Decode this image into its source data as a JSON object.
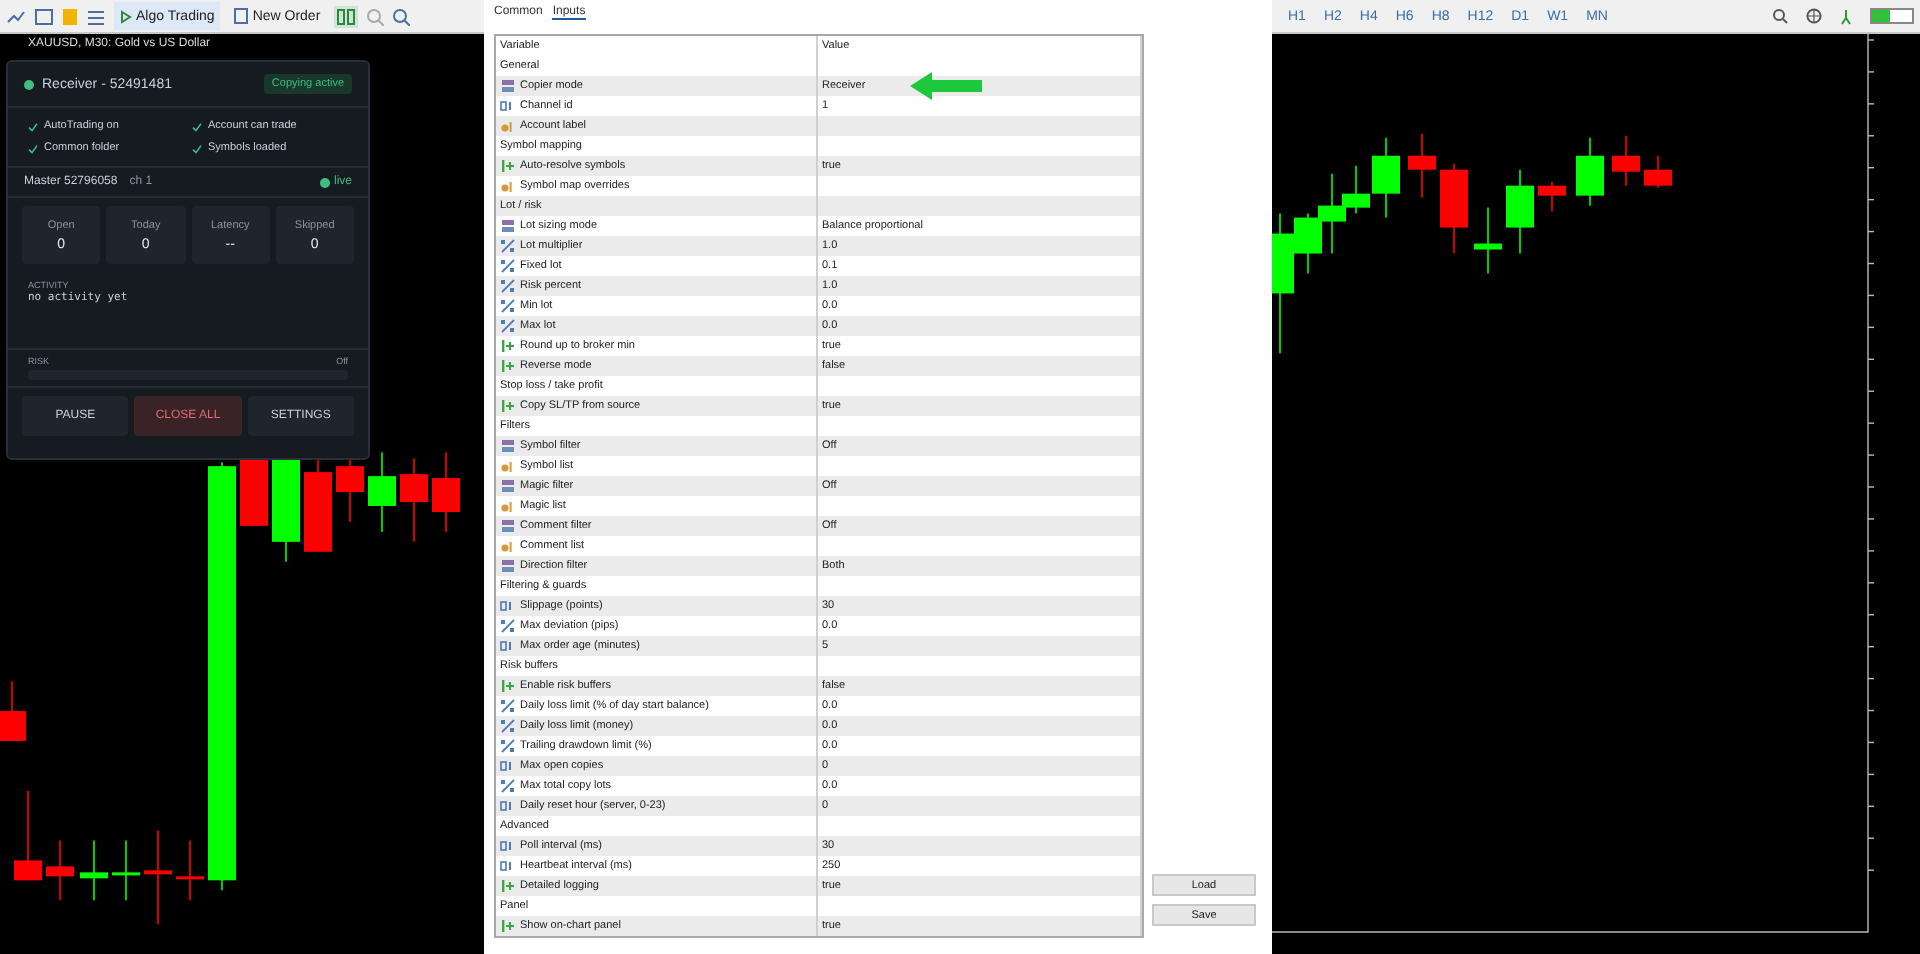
{
  "left_toolbar": {
    "buttons": [
      {
        "label": "Algo Trading",
        "selected": true
      },
      {
        "label": "New Order",
        "selected": false
      }
    ]
  },
  "chart_title": "XAUUSD, M30: Gold vs US Dollar",
  "copier_panel": {
    "title": "Receiver - 52491481",
    "status": "Copying active",
    "checks": [
      {
        "label": "AutoTrading on",
        "checked": true
      },
      {
        "label": "Account can trade",
        "checked": true
      },
      {
        "label": "Common folder",
        "checked": true
      },
      {
        "label": "Symbols loaded",
        "checked": true
      }
    ],
    "master": "Master 52796058",
    "channel": "ch 1",
    "link": "live",
    "stats": [
      {
        "label": "Open",
        "value": "0"
      },
      {
        "label": "Today",
        "value": "0"
      },
      {
        "label": "Latency",
        "value": "--"
      },
      {
        "label": "Skipped",
        "value": "0"
      }
    ],
    "activity_label": "ACTIVITY",
    "activity": "no activity yet",
    "risk_label": "RISK",
    "risk_value": "Off",
    "buttons": [
      {
        "label": "PAUSE",
        "kind": "normal"
      },
      {
        "label": "CLOSE ALL",
        "kind": "danger"
      },
      {
        "label": "SETTINGS",
        "kind": "normal"
      }
    ]
  },
  "dialog": {
    "tabs": [
      {
        "label": "Common",
        "selected": false
      },
      {
        "label": "Inputs",
        "selected": true
      }
    ],
    "columns": [
      "Variable",
      "Value"
    ],
    "rows": [
      {
        "kind": "group",
        "variable": "General"
      },
      {
        "kind": "enum",
        "variable": "Copier mode",
        "value": "Receiver"
      },
      {
        "kind": "int",
        "variable": "Channel id",
        "value": "1"
      },
      {
        "kind": "string",
        "variable": "Account label"
      },
      {
        "kind": "group",
        "variable": "Symbol mapping"
      },
      {
        "kind": "bool",
        "variable": "Auto-resolve symbols",
        "value": "true"
      },
      {
        "kind": "string",
        "variable": "Symbol map overrides"
      },
      {
        "kind": "group",
        "variable": "Lot / risk"
      },
      {
        "kind": "enum",
        "variable": "Lot sizing mode",
        "value": "Balance proportional"
      },
      {
        "kind": "double",
        "variable": "Lot multiplier",
        "value": "1.0"
      },
      {
        "kind": "double",
        "variable": "Fixed lot",
        "value": "0.1"
      },
      {
        "kind": "double",
        "variable": "Risk percent",
        "value": "1.0"
      },
      {
        "kind": "double",
        "variable": "Min lot",
        "value": "0.0"
      },
      {
        "kind": "double",
        "variable": "Max lot",
        "value": "0.0"
      },
      {
        "kind": "bool",
        "variable": "Round up to broker min",
        "value": "true"
      },
      {
        "kind": "bool",
        "variable": "Reverse mode",
        "value": "false"
      },
      {
        "kind": "group",
        "variable": "Stop loss / take profit"
      },
      {
        "kind": "bool",
        "variable": "Copy SL/TP from source",
        "value": "true"
      },
      {
        "kind": "group",
        "variable": "Filters"
      },
      {
        "kind": "enum",
        "variable": "Symbol filter",
        "value": "Off"
      },
      {
        "kind": "string",
        "variable": "Symbol list"
      },
      {
        "kind": "enum",
        "variable": "Magic filter",
        "value": "Off"
      },
      {
        "kind": "string",
        "variable": "Magic list"
      },
      {
        "kind": "enum",
        "variable": "Comment filter",
        "value": "Off"
      },
      {
        "kind": "string",
        "variable": "Comment list"
      },
      {
        "kind": "enum",
        "variable": "Direction filter",
        "value": "Both"
      },
      {
        "kind": "group",
        "variable": "Filtering & guards"
      },
      {
        "kind": "int",
        "variable": "Slippage (points)",
        "value": "30"
      },
      {
        "kind": "double",
        "variable": "Max deviation (pips)",
        "value": "0.0"
      },
      {
        "kind": "int",
        "variable": "Max order age (minutes)",
        "value": "5"
      },
      {
        "kind": "group",
        "variable": "Risk buffers"
      },
      {
        "kind": "bool",
        "variable": "Enable risk buffers",
        "value": "false"
      },
      {
        "kind": "double",
        "variable": "Daily loss limit (% of day start balance)",
        "value": "0.0"
      },
      {
        "kind": "double",
        "variable": "Daily loss limit (money)",
        "value": "0.0"
      },
      {
        "kind": "double",
        "variable": "Trailing drawdown limit (%)",
        "value": "0.0"
      },
      {
        "kind": "int",
        "variable": "Max open copies",
        "value": "0"
      },
      {
        "kind": "double",
        "variable": "Max total copy lots",
        "value": "0.0"
      },
      {
        "kind": "int",
        "variable": "Daily reset hour (server, 0-23)",
        "value": "0"
      },
      {
        "kind": "group",
        "variable": "Advanced"
      },
      {
        "kind": "int",
        "variable": "Poll interval (ms)",
        "value": "30"
      },
      {
        "kind": "int",
        "variable": "Heartbeat interval (ms)",
        "value": "250"
      },
      {
        "kind": "bool",
        "variable": "Detailed logging",
        "value": "true"
      },
      {
        "kind": "group",
        "variable": "Panel"
      },
      {
        "kind": "bool",
        "variable": "Show on-chart panel",
        "value": "true"
      }
    ],
    "buttons": [
      "Load",
      "Save"
    ]
  },
  "right_toolbar": {
    "timeframes": [
      "H1",
      "H2",
      "H4",
      "H6",
      "H8",
      "H12",
      "D1",
      "W1",
      "MN"
    ]
  }
}
